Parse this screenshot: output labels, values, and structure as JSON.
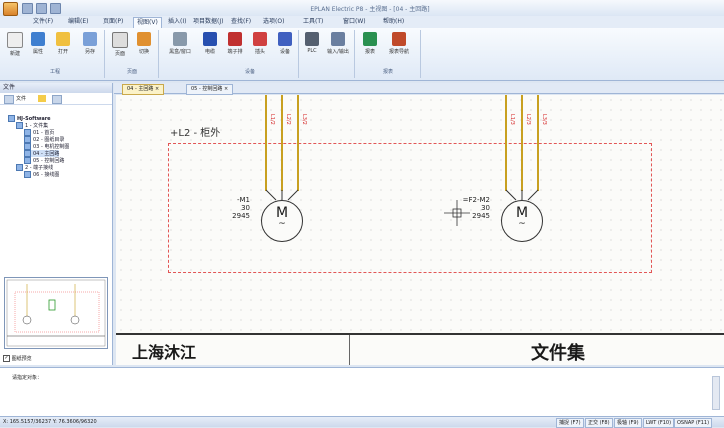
{
  "window": {
    "title": "EPLAN Electric P8 - 主视图 - [04 - 主回路]"
  },
  "watermark": "优酷",
  "menu": [
    "文件(F)",
    "编辑(E)",
    "页面(P)",
    "视图(V)",
    "插入(I)",
    "项目数据(J)",
    "查找(F)",
    "选项(O)",
    "工具(T)",
    "窗口(W)",
    "帮助(H)"
  ],
  "ribbon": {
    "buttons": [
      "新建",
      "属性",
      "打开",
      "另存",
      "页面",
      "切换",
      "黑盒/窗口",
      "电缆",
      "端子排",
      "插头",
      "设备",
      "PLC",
      "输入/输出",
      "报表",
      "报表导航"
    ],
    "groups": [
      "工程",
      "页面",
      "部件",
      "设备",
      "报表"
    ]
  },
  "docpanel": {
    "title": "文件",
    "filter": "文件",
    "tree": [
      "HJ-Software",
      "1 - 文件集",
      "01 - 首页",
      "02 - 图纸目录",
      "03 - 电机控制图",
      "04 - 主回路",
      "05 - 控制回路",
      "2 - 端子接线",
      "06 - 接线图"
    ],
    "checkbox_label": "图纸预览"
  },
  "doctabs": [
    "04 - 主回路",
    "05 - 控制回路"
  ],
  "canvas": {
    "frame_label": "+L2 - 柜外",
    "motor_symbol": "M",
    "ac_symbol": "~",
    "wire_tags": [
      "L1/2",
      "L2/2",
      "L3/2",
      "L1/3",
      "L2/3",
      "L3/3"
    ],
    "motors": [
      {
        "designation": "-M1",
        "line2": "30",
        "line3": "2945"
      },
      {
        "designation": "=F2-M2",
        "line2": "30",
        "line3": "2945"
      }
    ],
    "title_block": {
      "company": "上海沐江",
      "doc": "文件集"
    }
  },
  "command": {
    "prompt": "请指定对象："
  },
  "status": {
    "coords": "X: 165.5157/36237  Y: 76.3606/96320",
    "items": [
      "捕捉 (F7)",
      "正交 (F8)",
      "极轴 (F9)",
      "LWT (F10)",
      "OSNAP (F11)"
    ]
  }
}
